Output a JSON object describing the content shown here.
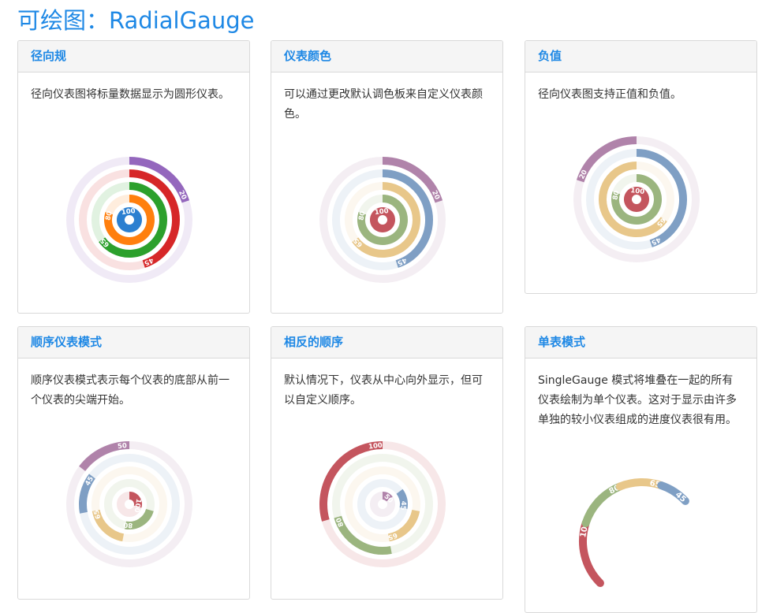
{
  "page": {
    "title": "可绘图：RadialGauge"
  },
  "cards": [
    {
      "id": "card-1",
      "title": "径向规",
      "description": "径向仪表图将标量数据显示为圆形仪表。",
      "chart_data": {
        "type": "radial-gauge",
        "mode": "default",
        "start_angle_deg": 0,
        "max": 100,
        "gauges": [
          {
            "value": 100,
            "label": "100",
            "color": "#2b7fd0"
          },
          {
            "value": 80,
            "label": "80",
            "color": "#ff7f0e"
          },
          {
            "value": 65,
            "label": "65",
            "color": "#2ca02c"
          },
          {
            "value": 45,
            "label": "45",
            "color": "#d62728"
          },
          {
            "value": 20,
            "label": "20",
            "color": "#9467bd"
          }
        ]
      }
    },
    {
      "id": "card-2",
      "title": "仪表颜色",
      "description": "可以通过更改默认调色板来自定义仪表颜色。",
      "chart_data": {
        "type": "radial-gauge",
        "mode": "default",
        "start_angle_deg": 0,
        "max": 100,
        "gauges": [
          {
            "value": 100,
            "label": "100",
            "color": "#c4555e"
          },
          {
            "value": 80,
            "label": "80",
            "color": "#9bb57f"
          },
          {
            "value": 65,
            "label": "65",
            "color": "#e8c78a"
          },
          {
            "value": 45,
            "label": "45",
            "color": "#7f9fc4"
          },
          {
            "value": 20,
            "label": "20",
            "color": "#b083aa"
          }
        ]
      }
    },
    {
      "id": "card-3",
      "title": "负值",
      "description": "径向仪表图支持正值和负值。",
      "chart_data": {
        "type": "radial-gauge",
        "mode": "default",
        "start_angle_deg": 0,
        "max": 100,
        "gauges": [
          {
            "value": -100,
            "label": "100",
            "color": "#c4555e"
          },
          {
            "value": 80,
            "label": "80",
            "color": "#9bb57f"
          },
          {
            "value": -65,
            "label": "65",
            "color": "#e8c78a"
          },
          {
            "value": 45,
            "label": "45",
            "color": "#7f9fc4"
          },
          {
            "value": -20,
            "label": "20",
            "color": "#b083aa"
          }
        ]
      }
    },
    {
      "id": "card-4",
      "title": "顺序仪表模式",
      "description": "顺序仪表模式表示每个仪表的底部从前一个仪表的尖端开始。",
      "chart_data": {
        "type": "radial-gauge",
        "mode": "sequential",
        "start_angle_deg": 0,
        "max": 340,
        "gauges": [
          {
            "value": 100,
            "label": "100",
            "color": "#c4555e"
          },
          {
            "value": 80,
            "label": "80",
            "color": "#9bb57f"
          },
          {
            "value": 65,
            "label": "65",
            "color": "#e8c78a"
          },
          {
            "value": 45,
            "label": "45",
            "color": "#7f9fc4"
          },
          {
            "value": 50,
            "label": "50",
            "color": "#b083aa"
          }
        ]
      }
    },
    {
      "id": "card-5",
      "title": "相反的顺序",
      "description": "默认情况下，仪表从中心向外显示，但可以自定义顺序。",
      "chart_data": {
        "type": "radial-gauge",
        "mode": "sequential-reversed",
        "start_angle_deg": 0,
        "max": 340,
        "gauges": [
          {
            "value": 50,
            "label": "50",
            "color": "#b083aa"
          },
          {
            "value": 45,
            "label": "45",
            "color": "#7f9fc4"
          },
          {
            "value": 65,
            "label": "65",
            "color": "#e8c78a"
          },
          {
            "value": 80,
            "label": "80",
            "color": "#9bb57f"
          },
          {
            "value": 100,
            "label": "100",
            "color": "#c4555e"
          }
        ]
      }
    },
    {
      "id": "card-6",
      "title": "单表模式",
      "description": "SingleGauge 模式将堆叠在一起的所有仪表绘制为单个仪表。这对于显示由许多单独的较小仪表组成的进度仪表很有用。",
      "chart_data": {
        "type": "radial-gauge",
        "mode": "single",
        "start_angle_deg": -135,
        "max": 430,
        "gauges": [
          {
            "value": 100,
            "label": "100",
            "color": "#c4555e"
          },
          {
            "value": 80,
            "label": "80",
            "color": "#9bb57f"
          },
          {
            "value": 65,
            "label": "65",
            "color": "#e8c78a"
          },
          {
            "value": 45,
            "label": "45",
            "color": "#7f9fc4"
          }
        ]
      }
    }
  ]
}
